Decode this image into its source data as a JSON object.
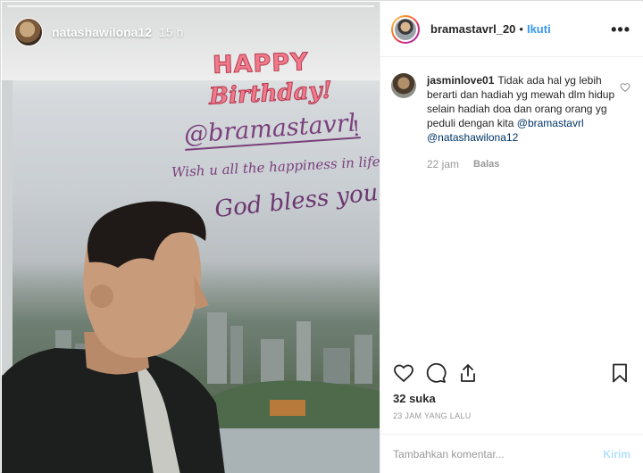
{
  "story": {
    "username": "natashawilona12",
    "time": "15 h",
    "greeting_line1": "HAPPY",
    "greeting_line2": "Birthday!",
    "mention": "@bramastavrl",
    "mention_suffix": "!",
    "wish": "Wish u all the happiness in life",
    "blessing": "God bless you!"
  },
  "post_header": {
    "username": "bramastavrl_20",
    "separator": "•",
    "follow_label": "Ikuti",
    "more_label": "•••"
  },
  "comments": [
    {
      "username": "jasminlove01",
      "text": "Tidak ada hal yg lebih berarti dan hadiah yg mewah dlm hidup selain hadiah doa dan orang orang yg peduli dengan kita",
      "mention1": "@bramastavrl",
      "mention2": "@natashawilona12",
      "time": "22 jam",
      "reply_label": "Balas"
    }
  ],
  "engagement": {
    "likes": "32 suka",
    "posted": "23 JAM YANG LALU"
  },
  "comment_box": {
    "placeholder": "Tambahkan komentar...",
    "send_label": "Kirim"
  },
  "colors": {
    "accent": "#3897f0",
    "text": "#262626",
    "muted": "#999999",
    "greeting": "#f07a8a",
    "mention": "#7a3f7c"
  },
  "icons": [
    "heart-icon",
    "comment-icon",
    "share-icon",
    "bookmark-icon",
    "more-icon",
    "like-comment-icon"
  ]
}
